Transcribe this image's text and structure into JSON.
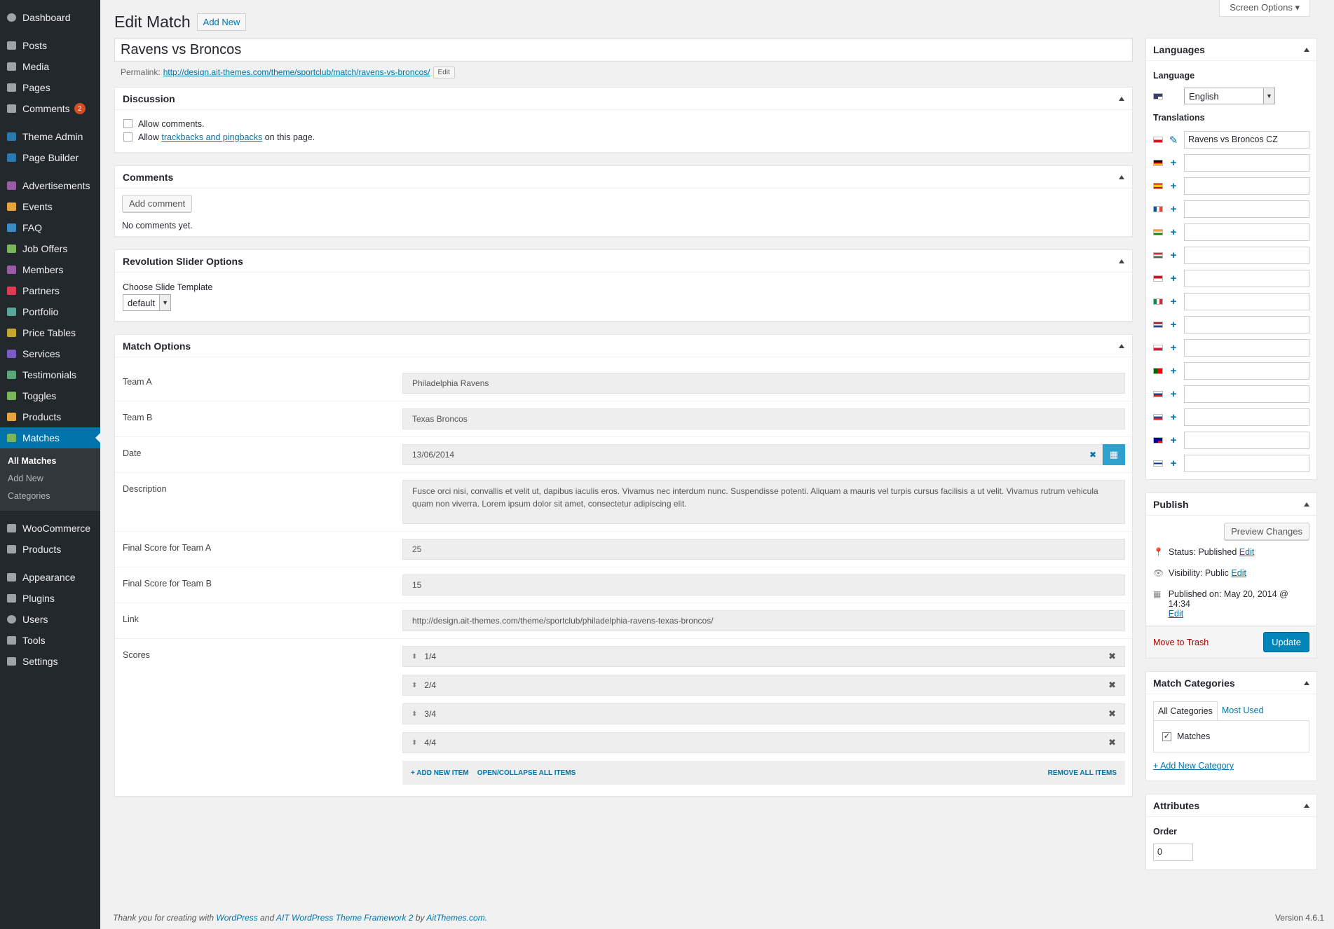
{
  "sidebar": {
    "items": [
      {
        "label": "Dashboard",
        "icon": "dashboard-icon"
      },
      {
        "label": "Posts",
        "icon": "pin-icon"
      },
      {
        "label": "Media",
        "icon": "media-icon"
      },
      {
        "label": "Pages",
        "icon": "pages-icon"
      },
      {
        "label": "Comments",
        "icon": "comments-icon",
        "badge": "2"
      },
      {
        "label": "Theme Admin",
        "icon": "ait-icon"
      },
      {
        "label": "Page Builder",
        "icon": "ait-icon"
      },
      {
        "label": "Advertisements",
        "icon": "advertisements-icon"
      },
      {
        "label": "Events",
        "icon": "events-icon"
      },
      {
        "label": "FAQ",
        "icon": "faq-icon"
      },
      {
        "label": "Job Offers",
        "icon": "job-offers-icon"
      },
      {
        "label": "Members",
        "icon": "members-icon"
      },
      {
        "label": "Partners",
        "icon": "partners-icon"
      },
      {
        "label": "Portfolio",
        "icon": "portfolio-icon"
      },
      {
        "label": "Price Tables",
        "icon": "price-tables-icon"
      },
      {
        "label": "Services",
        "icon": "services-icon"
      },
      {
        "label": "Testimonials",
        "icon": "testimonials-icon"
      },
      {
        "label": "Toggles",
        "icon": "toggles-icon"
      },
      {
        "label": "Products",
        "icon": "products-icon"
      },
      {
        "label": "Matches",
        "icon": "matches-icon"
      }
    ],
    "submenu": [
      "All Matches",
      "Add New",
      "Categories"
    ],
    "items2": [
      {
        "label": "WooCommerce",
        "icon": "woocommerce-icon"
      },
      {
        "label": "Products",
        "icon": "products-box-icon"
      },
      {
        "label": "Appearance",
        "icon": "appearance-icon"
      },
      {
        "label": "Plugins",
        "icon": "plugins-icon"
      },
      {
        "label": "Users",
        "icon": "users-icon"
      },
      {
        "label": "Tools",
        "icon": "tools-icon"
      },
      {
        "label": "Settings",
        "icon": "settings-icon"
      }
    ],
    "colors": {
      "icon_purple": "#9b5ba5",
      "icon_orange": "#e8a33c",
      "icon_green": "#7ab55c",
      "icon_blue": "#3c8ac6",
      "icon_red": "#dd3c54",
      "icon_teal": "#5aa79a",
      "icon_yellow": "#c4a62e"
    }
  },
  "header": {
    "screen_options": "Screen Options",
    "title": "Edit Match",
    "add_new": "Add New"
  },
  "post": {
    "title": "Ravens vs Broncos",
    "permalink_label": "Permalink:",
    "permalink_url": "http://design.ait-themes.com/theme/sportclub/match/ravens-vs-broncos/",
    "permalink_edit": "Edit"
  },
  "discussion": {
    "title": "Discussion",
    "allow_comments": "Allow comments.",
    "allow_prefix": "Allow",
    "allow_link": "trackbacks and pingbacks",
    "allow_suffix": "on this page."
  },
  "comments": {
    "title": "Comments",
    "add_button": "Add comment",
    "empty": "No comments yet."
  },
  "revslider": {
    "title": "Revolution Slider Options",
    "label": "Choose Slide Template",
    "value": "default"
  },
  "match": {
    "title": "Match Options",
    "team_a_label": "Team A",
    "team_a": "Philadelphia Ravens",
    "team_b_label": "Team B",
    "team_b": "Texas Broncos",
    "date_label": "Date",
    "date": "13/06/2014",
    "description_label": "Description",
    "description": "Fusce orci nisi, convallis et velit ut, dapibus iaculis eros. Vivamus nec interdum nunc. Suspendisse potenti. Aliquam a mauris vel turpis cursus facilisis a ut velit. Vivamus rutrum vehicula quam non viverra. Lorem ipsum dolor sit amet, consectetur adipiscing elit.",
    "score_a_label": "Final Score for Team A",
    "score_a": "25",
    "score_b_label": "Final Score for Team B",
    "score_b": "15",
    "link_label": "Link",
    "link": "http://design.ait-themes.com/theme/sportclub/philadelphia-ravens-texas-broncos/",
    "scores_label": "Scores",
    "scores": [
      "1/4",
      "2/4",
      "3/4",
      "4/4"
    ],
    "add_item": "+ ADD NEW ITEM",
    "toggle_items": "OPEN/COLLAPSE ALL ITEMS",
    "remove_items": "REMOVE ALL ITEMS"
  },
  "languages": {
    "title": "Languages",
    "language_label": "Language",
    "language_value": "English",
    "translations_label": "Translations",
    "translations": [
      {
        "flag": "cz",
        "value": "Ravens vs Broncos CZ",
        "icon": "pencil-icon"
      },
      {
        "flag": "de",
        "value": "",
        "icon": "plus-icon"
      },
      {
        "flag": "es",
        "value": "",
        "icon": "plus-icon"
      },
      {
        "flag": "fr",
        "value": "",
        "icon": "plus-icon"
      },
      {
        "flag": "in",
        "value": "",
        "icon": "plus-icon"
      },
      {
        "flag": "hu",
        "value": "",
        "icon": "plus-icon"
      },
      {
        "flag": "id",
        "value": "",
        "icon": "plus-icon"
      },
      {
        "flag": "it",
        "value": "",
        "icon": "plus-icon"
      },
      {
        "flag": "nl",
        "value": "",
        "icon": "plus-icon"
      },
      {
        "flag": "pl",
        "value": "",
        "icon": "plus-icon"
      },
      {
        "flag": "pt",
        "value": "",
        "icon": "plus-icon"
      },
      {
        "flag": "ru",
        "value": "",
        "icon": "plus-icon"
      },
      {
        "flag": "sk",
        "value": "",
        "icon": "plus-icon"
      },
      {
        "flag": "tw",
        "value": "",
        "icon": "plus-icon"
      },
      {
        "flag": "fi",
        "value": "",
        "icon": "plus-icon"
      }
    ]
  },
  "publish": {
    "title": "Publish",
    "preview": "Preview Changes",
    "status": "Status: Published",
    "visibility": "Visibility: Public",
    "published_on": "Published on: May 20, 2014 @ 14:34",
    "edit": "Edit",
    "trash": "Move to Trash",
    "update": "Update"
  },
  "categories": {
    "title": "Match Categories",
    "tab_all": "All Categories",
    "tab_used": "Most Used",
    "item": "Matches",
    "add_new": "+ Add New Category"
  },
  "attributes": {
    "title": "Attributes",
    "order_label": "Order",
    "order": "0"
  },
  "footer": {
    "thanks_prefix": "Thank you for creating with",
    "wp": "WordPress",
    "and": "and",
    "ait": "AIT WordPress Theme Framework 2",
    "by": "by",
    "aitthemes": "AitThemes.com",
    "dot": ".",
    "version": "Version 4.6.1"
  }
}
